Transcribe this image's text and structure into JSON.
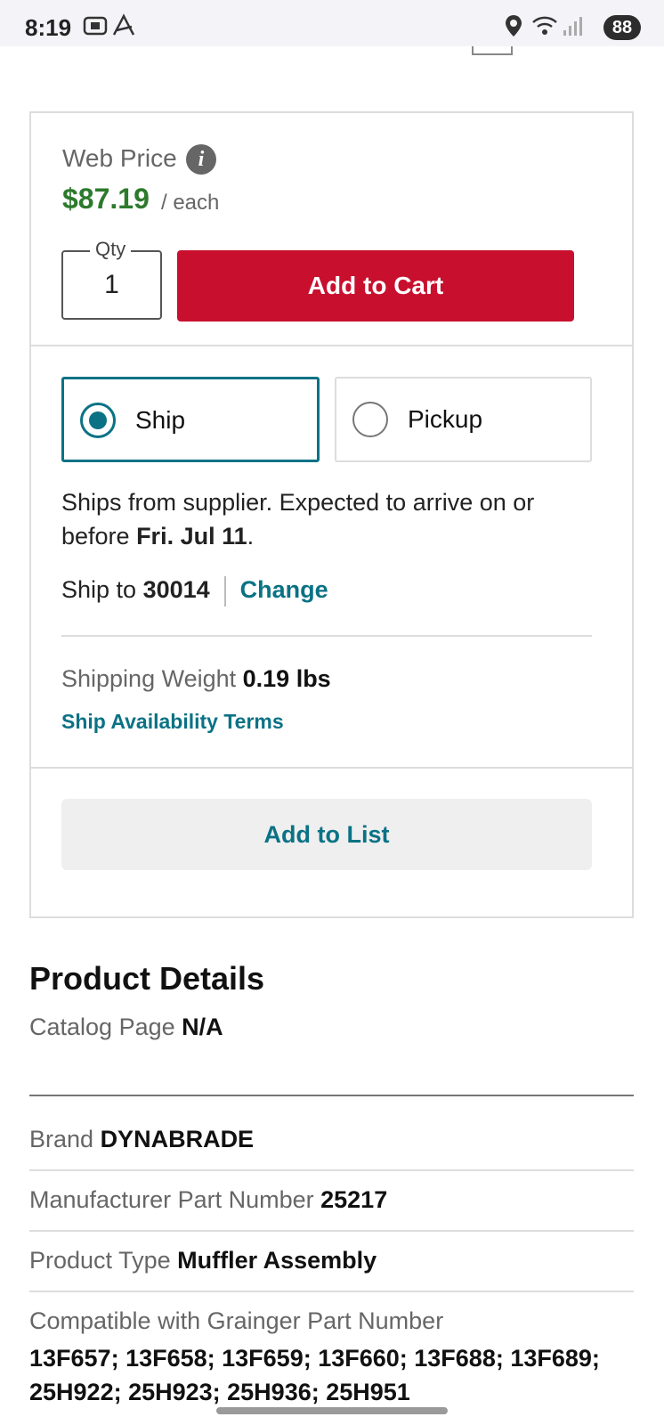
{
  "status_bar": {
    "time": "8:19",
    "battery": "88",
    "icons": [
      "screen-record-icon",
      "acrobat-icon",
      "location-icon",
      "wifi-icon",
      "signal-icon"
    ]
  },
  "price_card": {
    "web_price_label": "Web Price",
    "price": "$87.19",
    "unit": "/ each",
    "qty_label": "Qty",
    "qty_value": "1",
    "add_to_cart": "Add to Cart"
  },
  "fulfillment": {
    "ship_label": "Ship",
    "pickup_label": "Pickup",
    "selected": "Ship",
    "ship_message_prefix": "Ships from supplier. Expected to arrive on or before ",
    "arrival_date": "Fri. Jul 11",
    "ship_message_suffix": ".",
    "ship_to_label": "Ship to ",
    "zip": "30014",
    "change": "Change",
    "weight_label": "Shipping Weight ",
    "weight_value": "0.19 lbs",
    "terms": "Ship Availability Terms"
  },
  "add_to_list": "Add to List",
  "product_details": {
    "title": "Product Details",
    "catalog_page_label": "Catalog Page ",
    "catalog_page_value": "N/A",
    "brand_label": "Brand ",
    "brand_value": "DYNABRADE",
    "mpn_label": "Manufacturer Part Number ",
    "mpn_value": "25217",
    "type_label": "Product Type ",
    "type_value": "Muffler Assembly",
    "compat_label": "Compatible with Grainger Part Number",
    "compat_value": "13F657; 13F658; 13F659; 13F660; 13F688; 13F689; 25H922; 25H923; 25H936; 25H951"
  },
  "colors": {
    "brand_red": "#c8102e",
    "price_green": "#2d7a2d",
    "link_teal": "#0b7285"
  }
}
